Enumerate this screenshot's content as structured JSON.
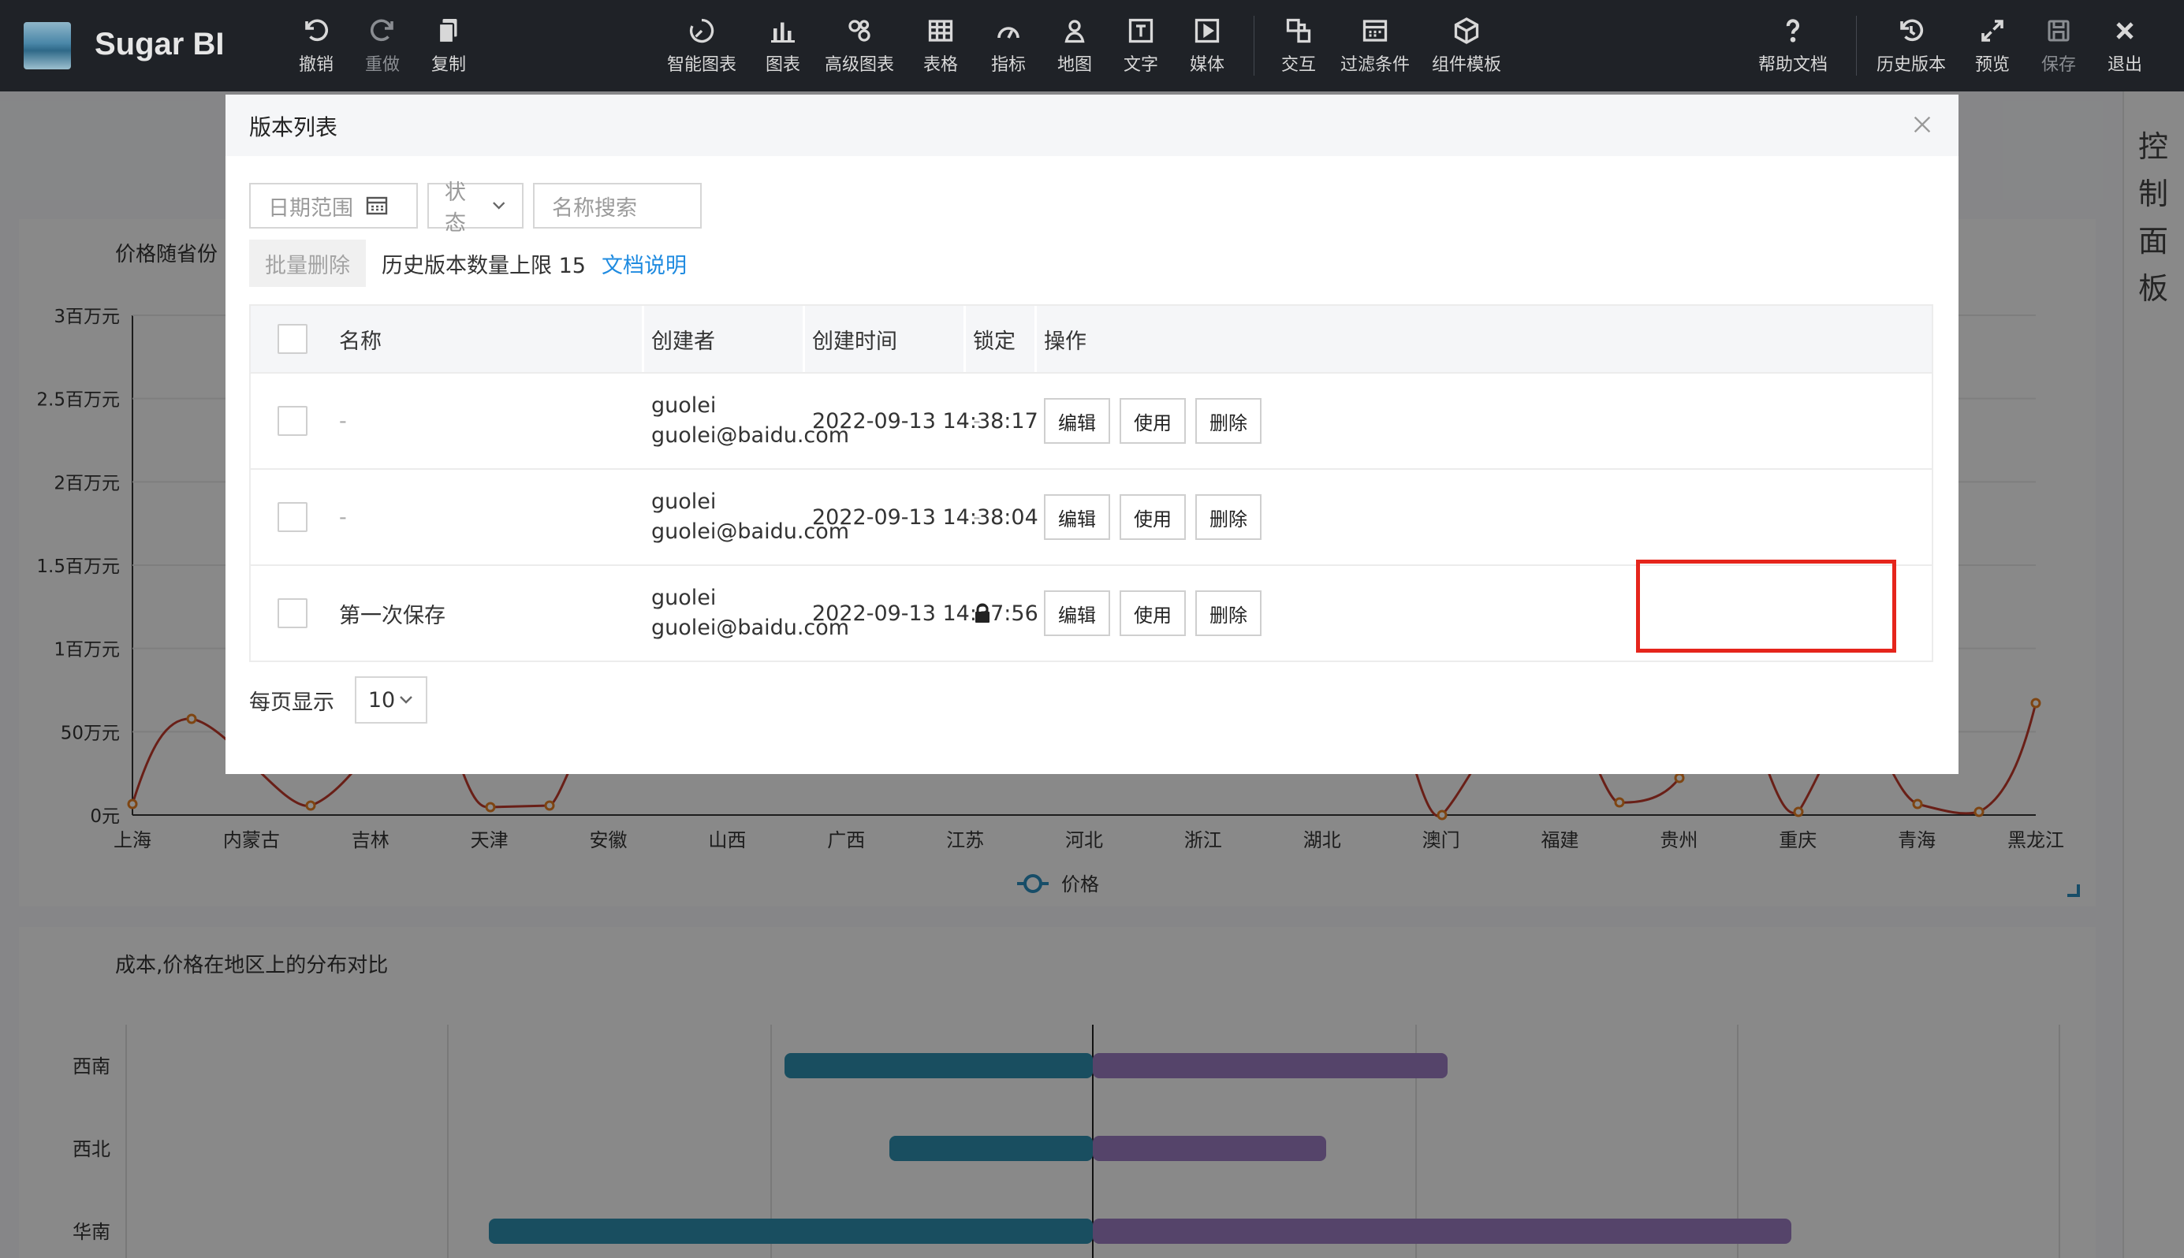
{
  "app": {
    "brand": "Sugar BI"
  },
  "toolbar": {
    "left": [
      {
        "label": "撤销",
        "icon": "undo-icon"
      },
      {
        "label": "重做",
        "icon": "redo-icon"
      },
      {
        "label": "复制",
        "icon": "copy-icon"
      }
    ],
    "center": [
      {
        "label": "智能图表",
        "icon": "smart-chart-icon"
      },
      {
        "label": "图表",
        "icon": "bar-chart-icon"
      },
      {
        "label": "高级图表",
        "icon": "advanced-chart-icon"
      },
      {
        "label": "表格",
        "icon": "table-icon"
      },
      {
        "label": "指标",
        "icon": "gauge-icon"
      },
      {
        "label": "地图",
        "icon": "map-pin-icon"
      },
      {
        "label": "文字",
        "icon": "text-icon"
      },
      {
        "label": "媒体",
        "icon": "media-icon"
      },
      {
        "label": "交互",
        "icon": "interaction-icon"
      },
      {
        "label": "过滤条件",
        "icon": "filter-icon"
      },
      {
        "label": "组件模板",
        "icon": "template-icon"
      }
    ],
    "right": [
      {
        "label": "帮助文档",
        "icon": "help-icon"
      },
      {
        "label": "历史版本",
        "icon": "history-icon"
      },
      {
        "label": "预览",
        "icon": "preview-icon"
      },
      {
        "label": "保存",
        "icon": "save-icon"
      },
      {
        "label": "退出",
        "icon": "exit-icon"
      }
    ]
  },
  "right_panel": {
    "label": [
      "控",
      "制",
      "面",
      "板"
    ]
  },
  "background": {
    "chart1_title": "价格随省份",
    "chart2_title": "成本,价格在地区上的分布对比",
    "chart1": {
      "type": "line",
      "y_ticks": [
        "3百万元",
        "2.5百万元",
        "2百万元",
        "1.5百万元",
        "1百万元",
        "50万元",
        "0元"
      ],
      "categories": [
        "上海",
        "内蒙古",
        "吉林",
        "天津",
        "安徽",
        "山西",
        "广西",
        "江苏",
        "河北",
        "浙江",
        "湖北",
        "澳门",
        "福建",
        "贵州",
        "重庆",
        "青海",
        "黑龙江"
      ],
      "legend": "价格"
    },
    "chart2": {
      "type": "bar",
      "categories": [
        "西南",
        "西北",
        "华南"
      ]
    }
  },
  "modal": {
    "title": "版本列表",
    "filters": {
      "date_range": "日期范围",
      "status": "状态",
      "name_search": "名称搜索"
    },
    "batch_delete": "批量删除",
    "limit_text": "历史版本数量上限 15",
    "doc_link": "文档说明",
    "columns": {
      "name": "名称",
      "creator": "创建者",
      "created_time": "创建时间",
      "lock": "锁定",
      "actions": "操作"
    },
    "rows": [
      {
        "name": "-",
        "creator_name": "guolei",
        "creator_email": "guolei@baidu.com",
        "time": "2022-09-13 14:38:17",
        "lock": "-",
        "locked": false
      },
      {
        "name": "-",
        "creator_name": "guolei",
        "creator_email": "guolei@baidu.com",
        "time": "2022-09-13 14:38:04",
        "lock": "-",
        "locked": false
      },
      {
        "name": "第一次保存",
        "creator_name": "guolei",
        "creator_email": "guolei@baidu.com",
        "time": "2022-09-13 14:37:56",
        "lock": "",
        "locked": true
      }
    ],
    "action_labels": {
      "edit": "编辑",
      "use": "使用",
      "delete": "删除"
    },
    "page_size_label": "每页显示",
    "page_size": "10"
  }
}
